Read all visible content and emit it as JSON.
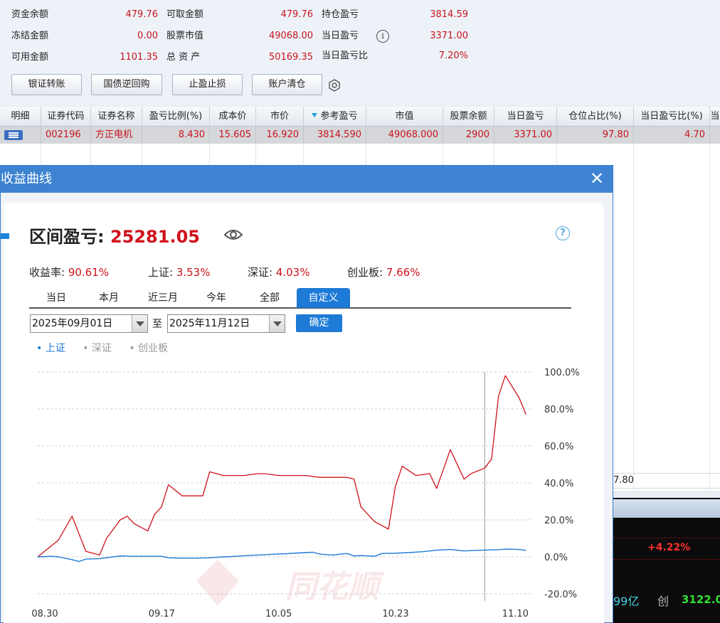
{
  "summary": {
    "rows": [
      {
        "label": "资金余额",
        "value": "479.76"
      },
      {
        "label": "冻结金额",
        "value": "0.00"
      },
      {
        "label": "可用金额",
        "value": "1101.35"
      },
      {
        "label": "可取金额",
        "value": "479.76"
      },
      {
        "label": "股票市值",
        "value": "49068.00"
      },
      {
        "label": "总 资 产",
        "value": "50169.35"
      },
      {
        "label": "持仓盈亏",
        "value": "3814.59"
      },
      {
        "label": "当日盈亏",
        "value": "3371.00"
      },
      {
        "label": "当日盈亏比",
        "value": "7.20%"
      }
    ]
  },
  "toolbar": {
    "buttons": [
      "银证转账",
      "国债逆回购",
      "止盈止损",
      "账户清仓"
    ]
  },
  "table": {
    "headers": [
      "明细",
      "证券代码",
      "证券名称",
      "盈亏比例(%)",
      "成本价",
      "市价",
      "参考盈亏",
      "市值",
      "股票余额",
      "当日盈亏",
      "仓位占比(%)",
      "当日盈亏比(%)",
      "当"
    ],
    "row": [
      "",
      "002196",
      "方正电机",
      "8.430",
      "15.605",
      "16.920",
      "3814.590",
      "49068.000",
      "2900",
      "3371.00",
      "97.80",
      "4.70",
      ""
    ],
    "partial_value": "7.80"
  },
  "background": {
    "pct": "+4.22%",
    "amount": "99亿",
    "chuang_label": "创",
    "chuang_value": "3122.0"
  },
  "dialog": {
    "title": "收益曲线",
    "close": "✕",
    "pnl_label": "区间盈亏: ",
    "pnl_value": "25281.05",
    "help": "?",
    "stats": [
      {
        "label": "收益率: ",
        "value": "90.61%"
      },
      {
        "label": "上证: ",
        "value": "3.53%"
      },
      {
        "label": "深证: ",
        "value": "4.03%"
      },
      {
        "label": "创业板: ",
        "value": "7.66%"
      }
    ],
    "tabs": [
      "当日",
      "本月",
      "近三月",
      "今年",
      "全部",
      "自定义"
    ],
    "active_tab": "自定义",
    "start_date": "2025年09月01日",
    "to_label": "至",
    "end_date": "2025年11月12日",
    "ok_label": "确定",
    "legend": [
      {
        "label": "• 上证",
        "active": true
      },
      {
        "label": "• 深证",
        "active": false
      },
      {
        "label": "• 创业板",
        "active": false
      }
    ],
    "watermark": "同花顺"
  },
  "colors": {
    "profit_red": "#d0111b",
    "accent_blue": "#1d7ad6",
    "title_blue": "#3d83d1"
  },
  "chart_data": {
    "type": "line",
    "y_tick_labels": [
      "100.0%",
      "80.0%",
      "60.0%",
      "40.0%",
      "20.0%",
      "0.0%",
      "-20.0%"
    ],
    "x_tick_labels": [
      "08.30",
      "09.17",
      "10.05",
      "10.23",
      "11.10"
    ],
    "ylim": [
      -20,
      100
    ],
    "xlim": [
      0,
      72
    ],
    "grid": true,
    "crosshair_x": 65,
    "series": [
      {
        "color": "#d0111b",
        "x": [
          0,
          3,
          5,
          7,
          9,
          10,
          12,
          13,
          14,
          16,
          17,
          18,
          19,
          21,
          22,
          24,
          25,
          27,
          29,
          30,
          32,
          33,
          35,
          37,
          39,
          41,
          43,
          44,
          45,
          46,
          47,
          49,
          51,
          52,
          53,
          55,
          57,
          58,
          60,
          62,
          63,
          65,
          66,
          67,
          68,
          70,
          71
        ],
        "y": [
          0,
          9,
          22,
          3,
          1,
          10,
          20,
          22,
          18,
          14,
          23,
          27,
          39,
          33,
          33,
          33,
          46,
          44,
          44,
          44,
          45,
          45,
          44,
          44,
          44,
          43,
          43,
          43,
          43,
          42,
          27,
          19,
          15,
          38,
          49,
          44,
          45,
          37,
          58,
          42,
          45,
          48,
          53,
          87,
          98,
          86,
          77
        ]
      },
      {
        "name": "上证",
        "color": "#1d7ad6",
        "x": [
          0,
          2,
          3,
          5,
          6,
          7,
          9,
          10,
          12,
          14,
          16,
          18,
          19,
          21,
          23,
          25,
          27,
          29,
          30,
          32,
          34,
          36,
          38,
          40,
          41,
          42,
          43,
          44,
          45,
          46,
          47,
          49,
          50,
          52,
          54,
          56,
          57,
          58,
          60,
          62,
          63,
          65,
          67,
          68,
          70,
          71
        ],
        "y": [
          0,
          0.3,
          0,
          -1.5,
          -2.5,
          -1.2,
          -1.0,
          -0.5,
          0.5,
          0.3,
          0.3,
          0.3,
          -0.5,
          -0.7,
          -0.7,
          -0.5,
          0,
          0.3,
          0.6,
          1,
          1.4,
          1.7,
          2.1,
          2.5,
          1.5,
          1.2,
          1,
          1.5,
          1.8,
          0.5,
          0.7,
          0.3,
          1.8,
          2,
          2.3,
          2.8,
          3.2,
          3.6,
          4,
          3.2,
          3.4,
          3.7,
          3.9,
          4.2,
          4.0,
          3.5
        ]
      }
    ]
  }
}
